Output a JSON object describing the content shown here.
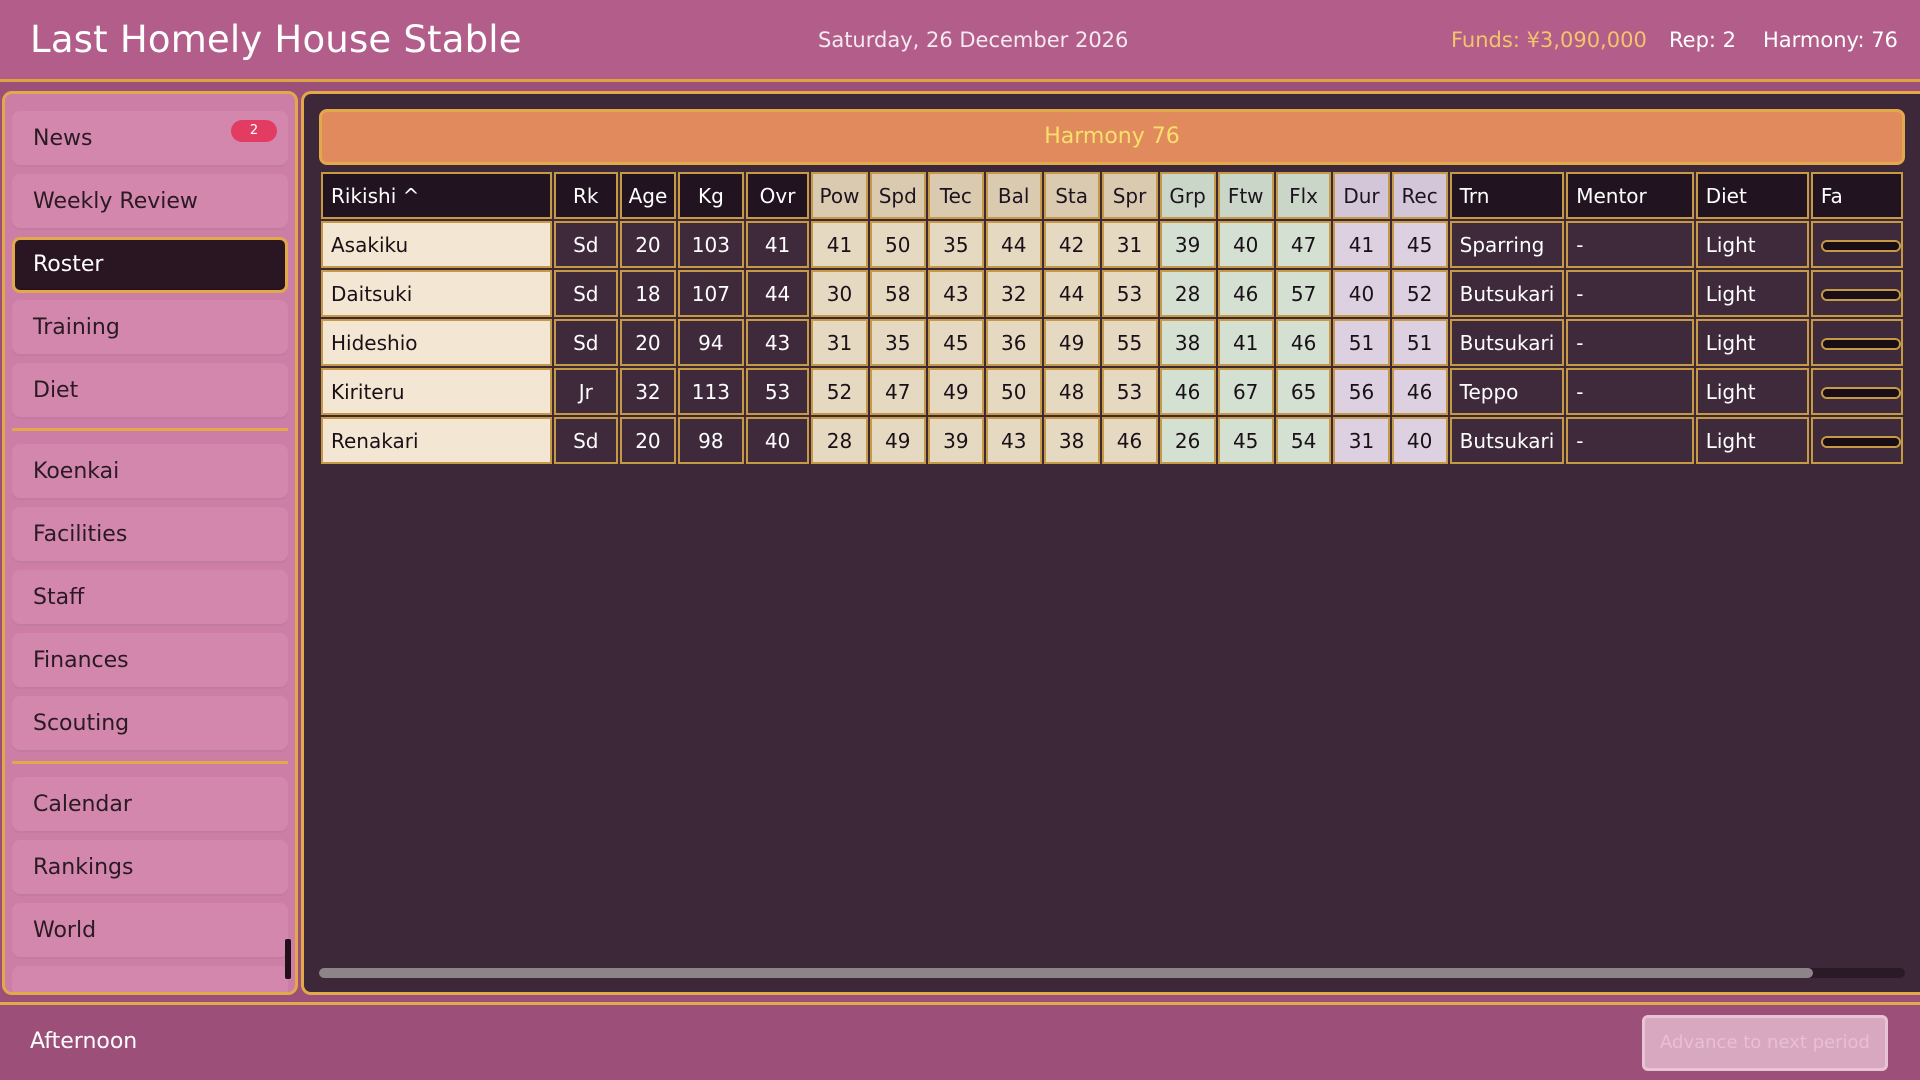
{
  "header": {
    "title": "Last Homely House Stable",
    "date": "Saturday, 26 December 2026",
    "funds": "Funds: ¥3,090,000",
    "rep": "Rep: 2",
    "harmony": "Harmony: 76"
  },
  "sidebar": {
    "news": {
      "label": "News",
      "badge": "2"
    },
    "weekly_review": "Weekly Review",
    "roster": "Roster",
    "training": "Training",
    "diet": "Diet",
    "koenkai": "Koenkai",
    "facilities": "Facilities",
    "staff": "Staff",
    "finances": "Finances",
    "scouting": "Scouting",
    "calendar": "Calendar",
    "rankings": "Rankings",
    "world": "World",
    "active": "Roster"
  },
  "main": {
    "banner": "Harmony 76",
    "columns": [
      "Rikishi ^",
      "Rk",
      "Age",
      "Kg",
      "Ovr",
      "Pow",
      "Spd",
      "Tec",
      "Bal",
      "Sta",
      "Spr",
      "Grp",
      "Ftw",
      "Flx",
      "Dur",
      "Rec",
      "Trn",
      "Mentor",
      "Diet",
      "Fa"
    ],
    "rows": [
      {
        "name": "Asakiku",
        "rk": "Sd",
        "age": "20",
        "kg": "103",
        "ovr": "41",
        "pow": "41",
        "spd": "50",
        "tec": "35",
        "bal": "44",
        "sta": "42",
        "spr": "31",
        "grp": "39",
        "ftw": "40",
        "flx": "47",
        "dur": "41",
        "rec": "45",
        "trn": "Sparring",
        "mentor": "-",
        "diet": "Light"
      },
      {
        "name": "Daitsuki",
        "rk": "Sd",
        "age": "18",
        "kg": "107",
        "ovr": "44",
        "pow": "30",
        "spd": "58",
        "tec": "43",
        "bal": "32",
        "sta": "44",
        "spr": "53",
        "grp": "28",
        "ftw": "46",
        "flx": "57",
        "dur": "40",
        "rec": "52",
        "trn": "Butsukari",
        "mentor": "-",
        "diet": "Light"
      },
      {
        "name": "Hideshio",
        "rk": "Sd",
        "age": "20",
        "kg": "94",
        "ovr": "43",
        "pow": "31",
        "spd": "35",
        "tec": "45",
        "bal": "36",
        "sta": "49",
        "spr": "55",
        "grp": "38",
        "ftw": "41",
        "flx": "46",
        "dur": "51",
        "rec": "51",
        "trn": "Butsukari",
        "mentor": "-",
        "diet": "Light"
      },
      {
        "name": "Kiriteru",
        "rk": "Jr",
        "age": "32",
        "kg": "113",
        "ovr": "53",
        "pow": "52",
        "spd": "47",
        "tec": "49",
        "bal": "50",
        "sta": "48",
        "spr": "53",
        "grp": "46",
        "ftw": "67",
        "flx": "65",
        "dur": "56",
        "rec": "46",
        "trn": "Teppo",
        "mentor": "-",
        "diet": "Light"
      },
      {
        "name": "Renakari",
        "rk": "Sd",
        "age": "20",
        "kg": "98",
        "ovr": "40",
        "pow": "28",
        "spd": "49",
        "tec": "39",
        "bal": "43",
        "sta": "38",
        "spr": "46",
        "grp": "26",
        "ftw": "45",
        "flx": "54",
        "dur": "31",
        "rec": "40",
        "trn": "Butsukari",
        "mentor": "-",
        "diet": "Light"
      }
    ]
  },
  "footer": {
    "time_of_day": "Afternoon",
    "advance_label": "Advance to next period"
  },
  "colors": {
    "header_bg": "#b35e8a",
    "accent_gold": "#e1a94a",
    "funds_text": "#f2c46b",
    "banner_bg": "#e08a5e",
    "badge_bg": "#e23c63"
  }
}
